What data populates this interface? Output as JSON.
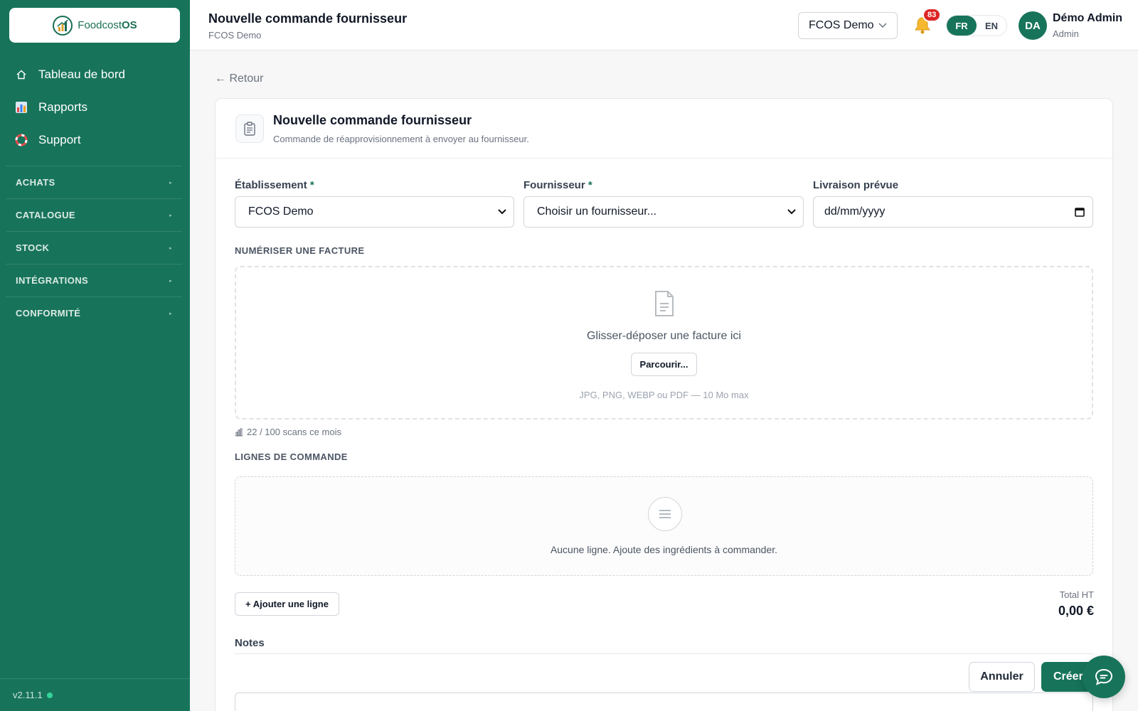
{
  "sidebar": {
    "logo": {
      "text_plain": "Foodcost",
      "text_bold": "OS"
    },
    "nav": [
      {
        "label": "Tableau de bord",
        "icon": "home-icon"
      },
      {
        "label": "Rapports",
        "icon": "bar-chart-icon"
      },
      {
        "label": "Support",
        "icon": "lifebuoy-icon"
      }
    ],
    "sections": [
      "ACHATS",
      "CATALOGUE",
      "STOCK",
      "INTÉGRATIONS",
      "CONFORMITÉ"
    ],
    "version": "v2.11.1"
  },
  "header": {
    "title": "Nouvelle commande fournisseur",
    "subtitle": "FCOS Demo",
    "org_selector": "FCOS Demo",
    "notifications_count": "83",
    "languages": [
      "FR",
      "EN"
    ],
    "active_language": "FR",
    "user_initials": "DA",
    "user_name": "Démo Admin",
    "user_role": "Admin"
  },
  "main": {
    "back_label": "← Retour",
    "card_title": "Nouvelle commande fournisseur",
    "card_subtitle": "Commande de réapprovisionnement à envoyer au fournisseur.",
    "fields": {
      "establishment": {
        "label": "Établissement",
        "required_mark": "*",
        "value": "FCOS Demo"
      },
      "supplier": {
        "label": "Fournisseur",
        "required_mark": "*",
        "value": "Choisir un fournisseur..."
      },
      "delivery": {
        "label": "Livraison prévue",
        "placeholder": "dd/mm/yyyy"
      }
    },
    "scan": {
      "section_label": "NUMÉRISER UNE FACTURE",
      "drop_text": "Glisser-déposer une facture ici",
      "browse_label": "Parcourir...",
      "hint": "JPG, PNG, WEBP ou PDF — 10 Mo max",
      "usage": "22 / 100 scans ce mois"
    },
    "lines": {
      "section_label": "LIGNES DE COMMANDE",
      "empty_text": "Aucune ligne. Ajoute des ingrédients à commander.",
      "add_label": "+ Ajouter une ligne"
    },
    "total": {
      "label": "Total HT",
      "value": "0,00 €"
    },
    "notes_label": "Notes",
    "cancel_label": "Annuler",
    "create_label": "Créer"
  },
  "colors": {
    "brand": "#17745a",
    "badge": "#dc2626",
    "status_dot": "#34d399"
  }
}
